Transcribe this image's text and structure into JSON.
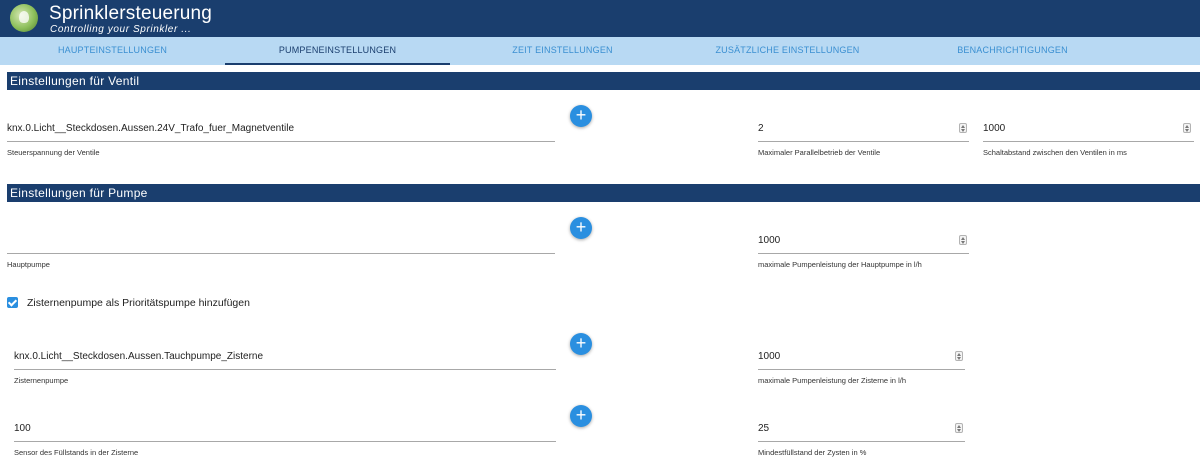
{
  "app": {
    "title": "Sprinklersteuerung",
    "subtitle": "Controlling your Sprinkler ..."
  },
  "tabs": [
    {
      "label": "HAUPTEINSTELLUNGEN",
      "active": false
    },
    {
      "label": "PUMPENEINSTELLUNGEN",
      "active": true
    },
    {
      "label": "ZEIT EINSTELLUNGEN",
      "active": false
    },
    {
      "label": "ZUSÄTZLICHE EINSTELLUNGEN",
      "active": false
    },
    {
      "label": "BENACHRICHTIGUNGEN",
      "active": false
    }
  ],
  "ventil": {
    "heading": "Einstellungen für Ventil",
    "steuerspannung": {
      "value": "knx.0.Licht__Steckdosen.Aussen.24V_Trafo_fuer_Magnetventile",
      "label": "Steuerspannung der Ventile"
    },
    "parallel": {
      "value": "2",
      "label": "Maximaler Parallelbetrieb der Ventile"
    },
    "schaltabstand": {
      "value": "1000",
      "label": "Schaltabstand zwischen den Ventilen in ms"
    }
  },
  "pumpe": {
    "heading": "Einstellungen für Pumpe",
    "hauptpumpe": {
      "value": "",
      "label": "Hauptpumpe"
    },
    "hauptpumpe_leistung": {
      "value": "1000",
      "label": "maximale Pumpenleistung der Hauptpumpe in l/h"
    },
    "zisterne_checkbox": {
      "label": "Zisternenpumpe als Prioritätspumpe hinzufügen",
      "checked": true
    },
    "zisternenpumpe": {
      "value": "knx.0.Licht__Steckdosen.Aussen.Tauchpumpe_Zisterne",
      "label": "Zisternenpumpe"
    },
    "zisterne_leistung": {
      "value": "1000",
      "label": "maximale Pumpenleistung der Zisterne in l/h"
    },
    "fuellstand_sensor": {
      "value": "100",
      "label": "Sensor des Füllstands in der Zisterne"
    },
    "mindestfuellstand": {
      "value": "25",
      "label": "Mindestfüllstand der Zysten in %"
    }
  },
  "icons": {
    "add": "+",
    "add_name": "plus-icon",
    "logo": "sprinkler-logo-icon",
    "check": "check-icon"
  },
  "colors": {
    "header": "#1a3e6e",
    "tabbar": "#b8d9f3",
    "tab_text": "#3a8fd1",
    "accent": "#2a8fe0"
  }
}
